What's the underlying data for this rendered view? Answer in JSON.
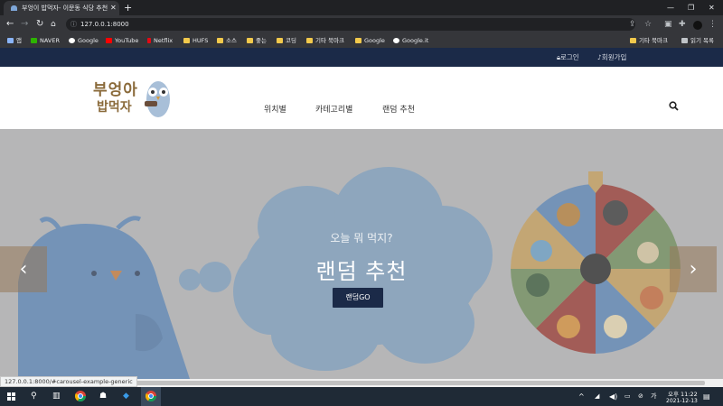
{
  "browser": {
    "tab_title": "부엉이 밥먹자- 이문동 식당 추천",
    "new_tab": "+",
    "window_controls": [
      "—",
      "❐",
      "✕"
    ],
    "address": "127.0.0.1:8000",
    "bookmarks": [
      {
        "label": "앱",
        "color": "#8ab4f8"
      },
      {
        "label": "NAVER",
        "color": "#2db400"
      },
      {
        "label": "Google",
        "color": "#ffffff"
      },
      {
        "label": "YouTube",
        "color": "#ff0000"
      },
      {
        "label": "Netflix",
        "color": "#e50914"
      },
      {
        "label": "HUFS",
        "color": "#f2c94c"
      },
      {
        "label": "소스",
        "color": "#f2c94c"
      },
      {
        "label": "좋는",
        "color": "#f2c94c"
      },
      {
        "label": "코딩",
        "color": "#f2c94c"
      },
      {
        "label": "기타 북마크",
        "color": "#f2c94c"
      },
      {
        "label": "Google",
        "color": "#f2c94c"
      },
      {
        "label": "Google.it",
        "color": "#ffffff"
      }
    ],
    "other_bookmarks": "기타 북마크",
    "reading_list": "읽기 목록"
  },
  "site": {
    "login": "로그인",
    "signup": "회원가입",
    "logo_line1": "부엉아",
    "logo_line2": "밥먹자",
    "nav": [
      "위치별",
      "카테고리별",
      "랜덤 추천"
    ],
    "hero_subtitle": "오늘 뭐 먹지?",
    "hero_title": "랜덤 추천",
    "hero_button": "랜덤GO",
    "prev_arrow": "‹",
    "next_arrow": "›"
  },
  "status_url": "127.0.0.1:8000/#carousel-example-generic",
  "taskbar": {
    "time": "오후 11:22",
    "date": "2021-12-13",
    "accent": "#3a7bd5"
  },
  "colors": {
    "navy": "#1b2a48",
    "hero_bg": "#b6b6b8",
    "cloud": "#7fa0bf",
    "owl": "#5b86b8"
  }
}
